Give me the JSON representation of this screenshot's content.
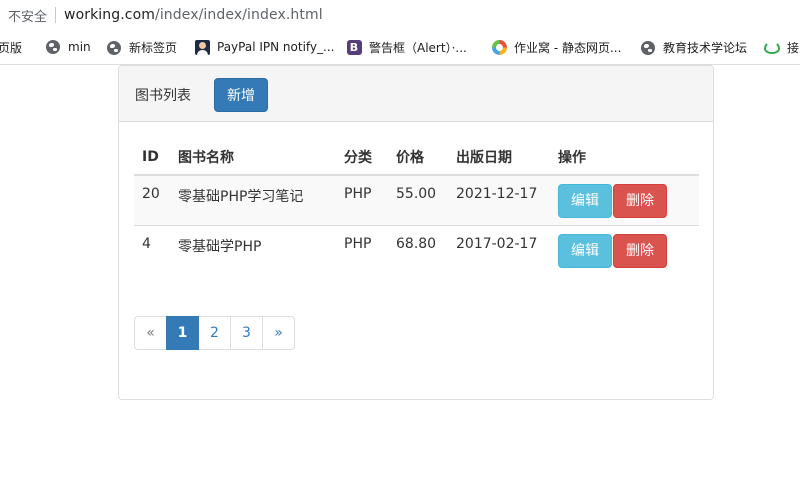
{
  "browser": {
    "security_label": "不安全",
    "url_host": "working.com",
    "url_path": "/index/index/index.html"
  },
  "bookmarks": [
    {
      "label": "页版",
      "icon": "none"
    },
    {
      "label": "min",
      "icon": "globe-icon"
    },
    {
      "label": "新标签页",
      "icon": "globe-icon"
    },
    {
      "label": "PayPal IPN notify_...",
      "icon": "avatar-icon"
    },
    {
      "label": "警告框（Alert）·...",
      "icon": "bootstrap-icon"
    },
    {
      "label": "作业窝 - 静态网页...",
      "icon": "zuoye-icon"
    },
    {
      "label": "教育技术学论坛",
      "icon": "globe-icon"
    },
    {
      "label": "接",
      "icon": "leaf-icon"
    }
  ],
  "panel": {
    "title": "图书列表",
    "add_button": "新增"
  },
  "table": {
    "headers": [
      "ID",
      "图书名称",
      "分类",
      "价格",
      "出版日期",
      "操作"
    ],
    "rows": [
      {
        "id": "20",
        "name": "零基础PHP学习笔记",
        "category": "PHP",
        "price": "55.00",
        "date": "2021-12-17",
        "edit": "编辑",
        "delete": "删除"
      },
      {
        "id": "4",
        "name": "零基础学PHP",
        "category": "PHP",
        "price": "68.80",
        "date": "2017-02-17",
        "edit": "编辑",
        "delete": "删除"
      }
    ]
  },
  "pagination": {
    "prev": "«",
    "pages": [
      "1",
      "2",
      "3"
    ],
    "active": "1",
    "next": "»"
  },
  "colors": {
    "primary": "#337ab7",
    "info": "#5bc0de",
    "danger": "#d9534f"
  }
}
